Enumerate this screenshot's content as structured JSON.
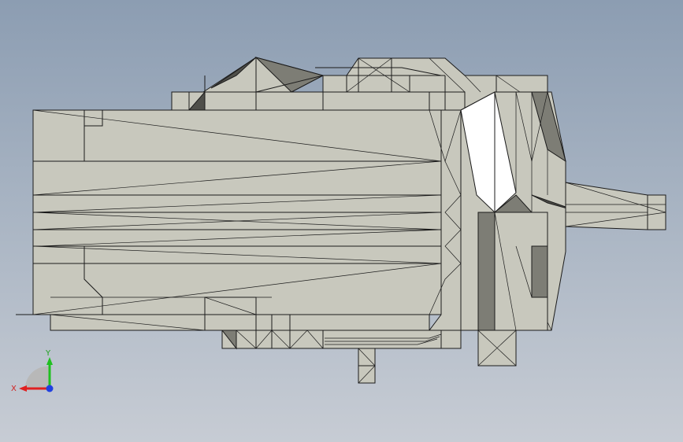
{
  "viewport": {
    "background_top": "#8c9db2",
    "background_bottom": "#c7ccd4"
  },
  "model": {
    "face_color": "#c8c8bd",
    "shade_color": "#7d7d75",
    "edge_color": "#1b1b1b"
  },
  "triad": {
    "x_label": "X",
    "y_label": "Y",
    "x_color": "#e02020",
    "y_color": "#20c020",
    "z_color": "#2040e0"
  }
}
